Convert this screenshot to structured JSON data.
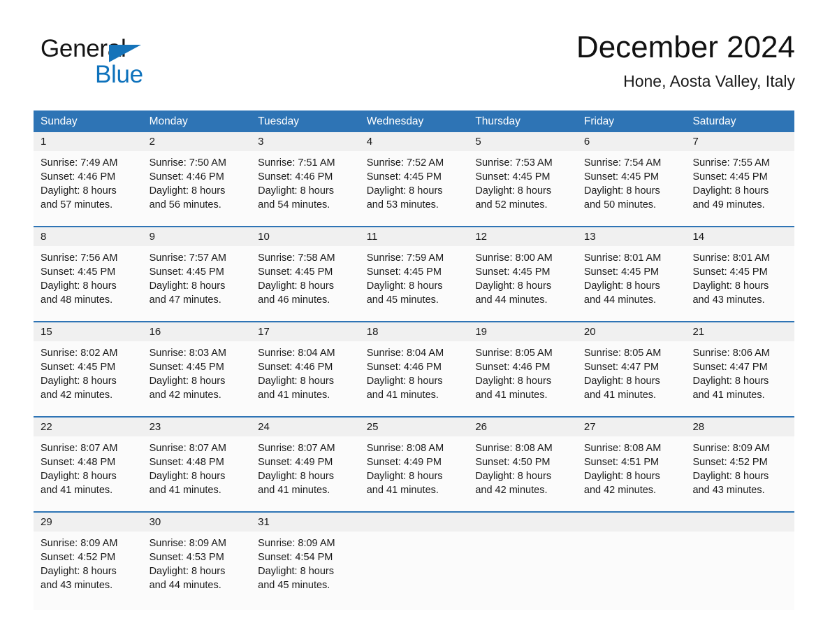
{
  "brand": {
    "name_part1": "General",
    "name_part2": "Blue",
    "flag_icon": "triangle-flag-icon",
    "accent_color": "#0E72BC"
  },
  "header": {
    "month_title": "December 2024",
    "location": "Hone, Aosta Valley, Italy"
  },
  "colors": {
    "header_blue": "#2E74B5",
    "daynum_band": "#F0F0F0",
    "cell_background": "#FBFBFB",
    "text": "#1a1a1a"
  },
  "calendar": {
    "weekdays": [
      "Sunday",
      "Monday",
      "Tuesday",
      "Wednesday",
      "Thursday",
      "Friday",
      "Saturday"
    ],
    "weeks": [
      {
        "days": [
          {
            "num": "1",
            "sunrise": "Sunrise: 7:49 AM",
            "sunset": "Sunset: 4:46 PM",
            "daylight1": "Daylight: 8 hours",
            "daylight2": "and 57 minutes."
          },
          {
            "num": "2",
            "sunrise": "Sunrise: 7:50 AM",
            "sunset": "Sunset: 4:46 PM",
            "daylight1": "Daylight: 8 hours",
            "daylight2": "and 56 minutes."
          },
          {
            "num": "3",
            "sunrise": "Sunrise: 7:51 AM",
            "sunset": "Sunset: 4:46 PM",
            "daylight1": "Daylight: 8 hours",
            "daylight2": "and 54 minutes."
          },
          {
            "num": "4",
            "sunrise": "Sunrise: 7:52 AM",
            "sunset": "Sunset: 4:45 PM",
            "daylight1": "Daylight: 8 hours",
            "daylight2": "and 53 minutes."
          },
          {
            "num": "5",
            "sunrise": "Sunrise: 7:53 AM",
            "sunset": "Sunset: 4:45 PM",
            "daylight1": "Daylight: 8 hours",
            "daylight2": "and 52 minutes."
          },
          {
            "num": "6",
            "sunrise": "Sunrise: 7:54 AM",
            "sunset": "Sunset: 4:45 PM",
            "daylight1": "Daylight: 8 hours",
            "daylight2": "and 50 minutes."
          },
          {
            "num": "7",
            "sunrise": "Sunrise: 7:55 AM",
            "sunset": "Sunset: 4:45 PM",
            "daylight1": "Daylight: 8 hours",
            "daylight2": "and 49 minutes."
          }
        ]
      },
      {
        "days": [
          {
            "num": "8",
            "sunrise": "Sunrise: 7:56 AM",
            "sunset": "Sunset: 4:45 PM",
            "daylight1": "Daylight: 8 hours",
            "daylight2": "and 48 minutes."
          },
          {
            "num": "9",
            "sunrise": "Sunrise: 7:57 AM",
            "sunset": "Sunset: 4:45 PM",
            "daylight1": "Daylight: 8 hours",
            "daylight2": "and 47 minutes."
          },
          {
            "num": "10",
            "sunrise": "Sunrise: 7:58 AM",
            "sunset": "Sunset: 4:45 PM",
            "daylight1": "Daylight: 8 hours",
            "daylight2": "and 46 minutes."
          },
          {
            "num": "11",
            "sunrise": "Sunrise: 7:59 AM",
            "sunset": "Sunset: 4:45 PM",
            "daylight1": "Daylight: 8 hours",
            "daylight2": "and 45 minutes."
          },
          {
            "num": "12",
            "sunrise": "Sunrise: 8:00 AM",
            "sunset": "Sunset: 4:45 PM",
            "daylight1": "Daylight: 8 hours",
            "daylight2": "and 44 minutes."
          },
          {
            "num": "13",
            "sunrise": "Sunrise: 8:01 AM",
            "sunset": "Sunset: 4:45 PM",
            "daylight1": "Daylight: 8 hours",
            "daylight2": "and 44 minutes."
          },
          {
            "num": "14",
            "sunrise": "Sunrise: 8:01 AM",
            "sunset": "Sunset: 4:45 PM",
            "daylight1": "Daylight: 8 hours",
            "daylight2": "and 43 minutes."
          }
        ]
      },
      {
        "days": [
          {
            "num": "15",
            "sunrise": "Sunrise: 8:02 AM",
            "sunset": "Sunset: 4:45 PM",
            "daylight1": "Daylight: 8 hours",
            "daylight2": "and 42 minutes."
          },
          {
            "num": "16",
            "sunrise": "Sunrise: 8:03 AM",
            "sunset": "Sunset: 4:45 PM",
            "daylight1": "Daylight: 8 hours",
            "daylight2": "and 42 minutes."
          },
          {
            "num": "17",
            "sunrise": "Sunrise: 8:04 AM",
            "sunset": "Sunset: 4:46 PM",
            "daylight1": "Daylight: 8 hours",
            "daylight2": "and 41 minutes."
          },
          {
            "num": "18",
            "sunrise": "Sunrise: 8:04 AM",
            "sunset": "Sunset: 4:46 PM",
            "daylight1": "Daylight: 8 hours",
            "daylight2": "and 41 minutes."
          },
          {
            "num": "19",
            "sunrise": "Sunrise: 8:05 AM",
            "sunset": "Sunset: 4:46 PM",
            "daylight1": "Daylight: 8 hours",
            "daylight2": "and 41 minutes."
          },
          {
            "num": "20",
            "sunrise": "Sunrise: 8:05 AM",
            "sunset": "Sunset: 4:47 PM",
            "daylight1": "Daylight: 8 hours",
            "daylight2": "and 41 minutes."
          },
          {
            "num": "21",
            "sunrise": "Sunrise: 8:06 AM",
            "sunset": "Sunset: 4:47 PM",
            "daylight1": "Daylight: 8 hours",
            "daylight2": "and 41 minutes."
          }
        ]
      },
      {
        "days": [
          {
            "num": "22",
            "sunrise": "Sunrise: 8:07 AM",
            "sunset": "Sunset: 4:48 PM",
            "daylight1": "Daylight: 8 hours",
            "daylight2": "and 41 minutes."
          },
          {
            "num": "23",
            "sunrise": "Sunrise: 8:07 AM",
            "sunset": "Sunset: 4:48 PM",
            "daylight1": "Daylight: 8 hours",
            "daylight2": "and 41 minutes."
          },
          {
            "num": "24",
            "sunrise": "Sunrise: 8:07 AM",
            "sunset": "Sunset: 4:49 PM",
            "daylight1": "Daylight: 8 hours",
            "daylight2": "and 41 minutes."
          },
          {
            "num": "25",
            "sunrise": "Sunrise: 8:08 AM",
            "sunset": "Sunset: 4:49 PM",
            "daylight1": "Daylight: 8 hours",
            "daylight2": "and 41 minutes."
          },
          {
            "num": "26",
            "sunrise": "Sunrise: 8:08 AM",
            "sunset": "Sunset: 4:50 PM",
            "daylight1": "Daylight: 8 hours",
            "daylight2": "and 42 minutes."
          },
          {
            "num": "27",
            "sunrise": "Sunrise: 8:08 AM",
            "sunset": "Sunset: 4:51 PM",
            "daylight1": "Daylight: 8 hours",
            "daylight2": "and 42 minutes."
          },
          {
            "num": "28",
            "sunrise": "Sunrise: 8:09 AM",
            "sunset": "Sunset: 4:52 PM",
            "daylight1": "Daylight: 8 hours",
            "daylight2": "and 43 minutes."
          }
        ]
      },
      {
        "days": [
          {
            "num": "29",
            "sunrise": "Sunrise: 8:09 AM",
            "sunset": "Sunset: 4:52 PM",
            "daylight1": "Daylight: 8 hours",
            "daylight2": "and 43 minutes."
          },
          {
            "num": "30",
            "sunrise": "Sunrise: 8:09 AM",
            "sunset": "Sunset: 4:53 PM",
            "daylight1": "Daylight: 8 hours",
            "daylight2": "and 44 minutes."
          },
          {
            "num": "31",
            "sunrise": "Sunrise: 8:09 AM",
            "sunset": "Sunset: 4:54 PM",
            "daylight1": "Daylight: 8 hours",
            "daylight2": "and 45 minutes."
          },
          {
            "num": "",
            "sunrise": "",
            "sunset": "",
            "daylight1": "",
            "daylight2": ""
          },
          {
            "num": "",
            "sunrise": "",
            "sunset": "",
            "daylight1": "",
            "daylight2": ""
          },
          {
            "num": "",
            "sunrise": "",
            "sunset": "",
            "daylight1": "",
            "daylight2": ""
          },
          {
            "num": "",
            "sunrise": "",
            "sunset": "",
            "daylight1": "",
            "daylight2": ""
          }
        ]
      }
    ]
  }
}
